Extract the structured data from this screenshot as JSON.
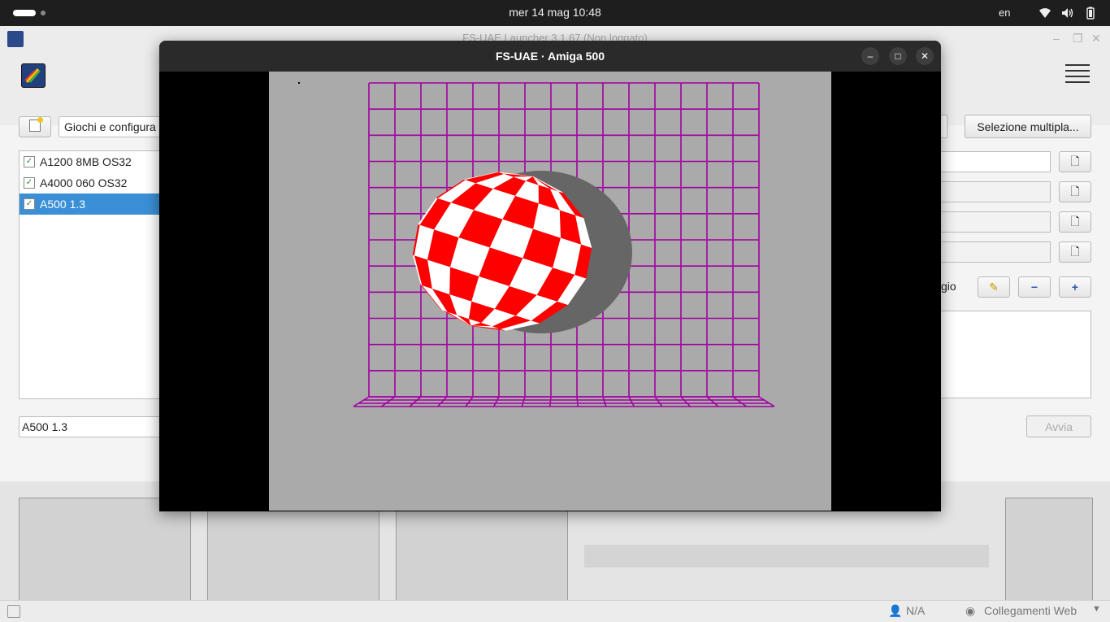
{
  "topbar": {
    "clock": "mer 14 mag  10:48",
    "language": "en",
    "icons": [
      "wifi-icon",
      "volume-icon",
      "battery-icon"
    ]
  },
  "launcher": {
    "title": "FS-UAE Launcher 3.1.67 (Non loggato)",
    "search_button_icon": "new-config-icon",
    "filter_value": "Giochi e configura",
    "multi_select_label": "Selezione multipla...",
    "configs": [
      {
        "label": "A1200 8MB OS32",
        "selected": false
      },
      {
        "label": "A4000 060 OS32",
        "selected": false
      },
      {
        "label": "A500 1.3",
        "selected": true
      }
    ],
    "config_name_value": "A500 1.3",
    "partial_label": "gio",
    "start_label": "Avvia",
    "status": {
      "net_label": "N/A",
      "web_links_label": "Collegamenti Web"
    }
  },
  "emulator": {
    "title": "FS-UAE · Amiga 500",
    "boing_colors": {
      "red": "#ff0000",
      "white": "#ffffff",
      "grid": "#a000a0",
      "shadow": "#666666",
      "background": "#aaaaaa"
    }
  }
}
